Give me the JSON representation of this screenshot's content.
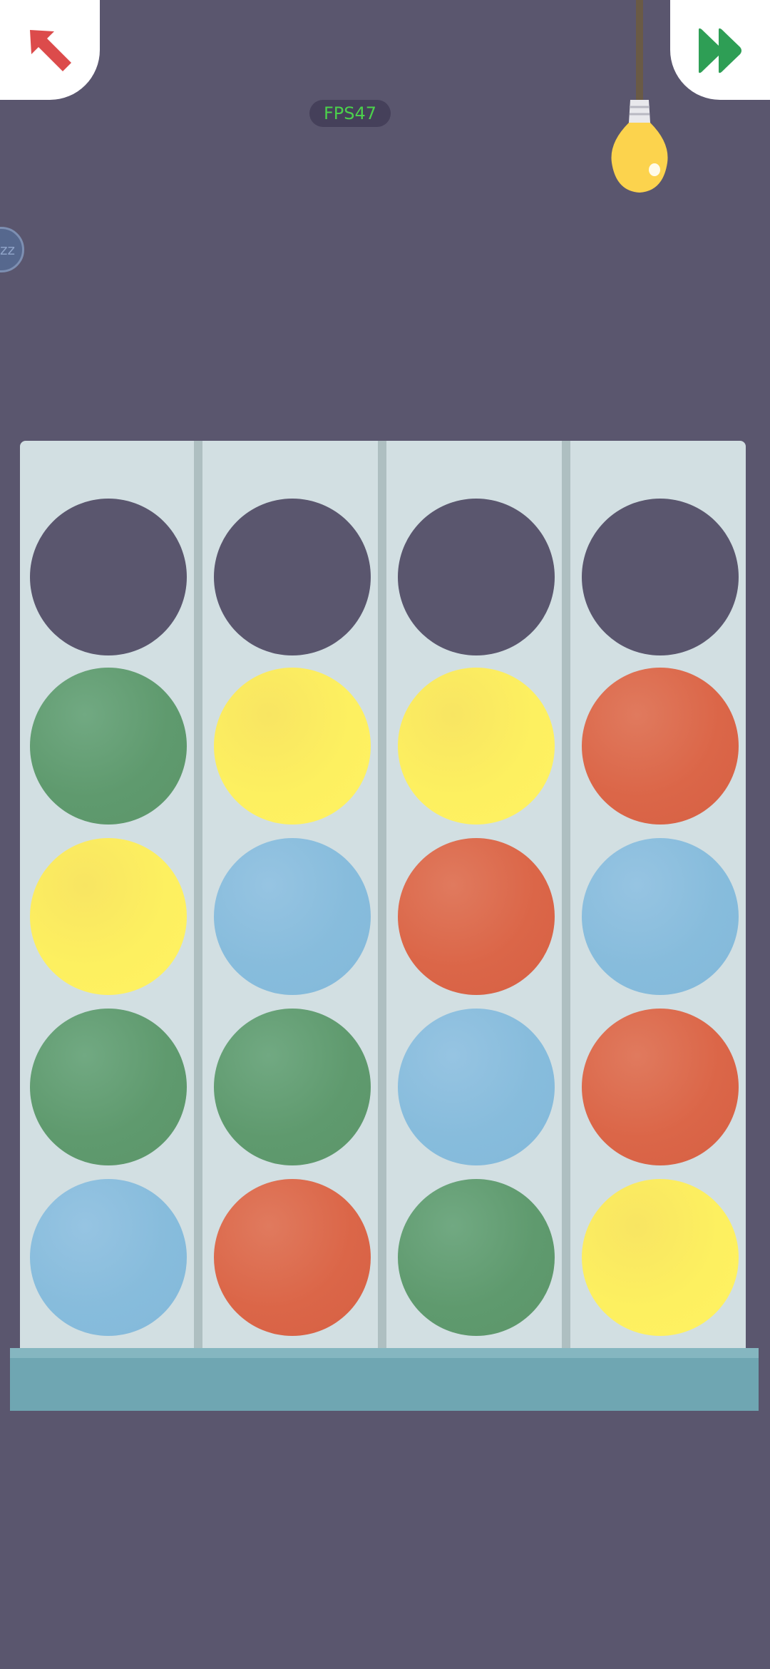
{
  "hud": {
    "back_icon": "arrow-up-left-icon",
    "skip_icon": "fast-forward-icon",
    "hint_icon": "lightbulb-icon",
    "fps_text": "FPS47",
    "sleep_badge_text": "zz"
  },
  "colors": {
    "background": "#5a566e",
    "board": "#d2dfe2",
    "board_base": "#6fa6b2",
    "back_arrow": "#dc4b4b",
    "skip_arrow": "#2e9e55",
    "bulb": "#fcd34d",
    "green": "#5f9a6e",
    "yellow": "#fdf060",
    "red": "#db6648",
    "blue": "#87bcdc"
  },
  "board": {
    "columns": [
      {
        "balls_top_to_bottom": [
          "empty",
          "green",
          "yellow",
          "green",
          "blue"
        ]
      },
      {
        "balls_top_to_bottom": [
          "empty",
          "yellow",
          "blue",
          "green",
          "red"
        ]
      },
      {
        "balls_top_to_bottom": [
          "empty",
          "yellow",
          "red",
          "blue",
          "green"
        ]
      },
      {
        "balls_top_to_bottom": [
          "empty",
          "red",
          "blue",
          "red",
          "yellow"
        ]
      }
    ]
  }
}
